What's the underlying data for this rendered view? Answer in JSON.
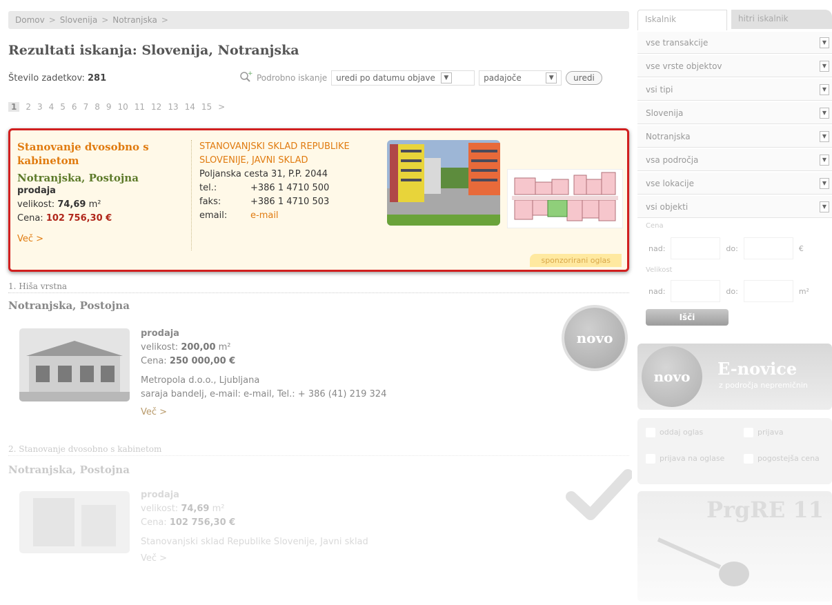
{
  "breadcrumb": [
    "Domov",
    "Slovenija",
    "Notranjska"
  ],
  "breadcrumb_sep": ">",
  "page_title": "Rezultati iskanja: Slovenija, Notranjska",
  "results": {
    "label": "Število zadetkov:",
    "value": "281"
  },
  "toolbar": {
    "advanced_search": "Podrobno iskanje",
    "sort_select": "uredi po datumu objave",
    "order_select": "padajoče",
    "sort_button": "uredi"
  },
  "pagination": {
    "pages": [
      "1",
      "2",
      "3",
      "4",
      "5",
      "6",
      "7",
      "8",
      "9",
      "10",
      "11",
      "12",
      "13",
      "14",
      "15"
    ],
    "next": ">"
  },
  "sponsored": {
    "title": "Stanovanje dvosobno s kabinetom",
    "location": "Notranjska, Postojna",
    "type": "prodaja",
    "size_label": "velikost:",
    "size_value": "74,69",
    "size_unit": "m²",
    "price_label": "Cena:",
    "price_value": "102 756,30 €",
    "more": "Več >",
    "org_name": "STANOVANJSKI SKLAD REPUBLIKE SLOVENIJE, JAVNI SKLAD",
    "address": "Poljanska cesta 31, P.P. 2044",
    "tel_label": "tel.:",
    "tel": "+386 1 4710 500",
    "fax_label": "faks:",
    "fax": "+386 1 4710 503",
    "email_label": "email:",
    "email_link": "e-mail",
    "badge": "sponzorirani oglas"
  },
  "listings": [
    {
      "header": "1. Hiša vrstna",
      "location": "Notranjska, Postojna",
      "type": "prodaja",
      "size_label": "velikost:",
      "size_value": "200,00",
      "size_unit": "m²",
      "price_label": "Cena:",
      "price_value": "250 000,00 €",
      "agency": "Metropola d.o.o., Ljubljana",
      "contact": "saraja bandelj, e-mail: e-mail, Tel.: + 386 (41) 219 324",
      "more": "Več >",
      "badge": "novo"
    },
    {
      "header": "2. Stanovanje dvosobno s kabinetom",
      "location": "Notranjska, Postojna",
      "type": "prodaja",
      "size_label": "velikost:",
      "size_value": "74,69",
      "size_unit": "m²",
      "price_label": "Cena:",
      "price_value": "102 756,30 €",
      "agency": "Stanovanjski sklad Republike Slovenije, Javni sklad",
      "more": "Več >"
    }
  ],
  "sidebar": {
    "tab_search": "Iskalnik",
    "tab_quick": "hitri iskalnik",
    "filters": [
      "vse transakcije",
      "vse vrste objektov",
      "vsi tipi",
      "Slovenija",
      "Notranjska",
      "vsa področja",
      "vse lokacije",
      "vsi objekti"
    ],
    "price_legend": "Cena",
    "size_legend": "Velikost",
    "from_label": "nad:",
    "to_label": "do:",
    "price_unit": "€",
    "size_unit": "m²",
    "go_button": "Išči",
    "enovice_badge": "novo",
    "enovice_title": "E-novice",
    "enovice_sub": "z področja nepremičnin",
    "links": [
      "oddaj oglas",
      "prijava",
      "prijava na oglase",
      "pogostejša cena"
    ],
    "banner_text": "PrgRE 11"
  },
  "colors": {
    "accent": "#e07b10",
    "price": "#b0261a",
    "location_green": "#5d7a2a",
    "sponsor_border": "#d11f1f"
  }
}
